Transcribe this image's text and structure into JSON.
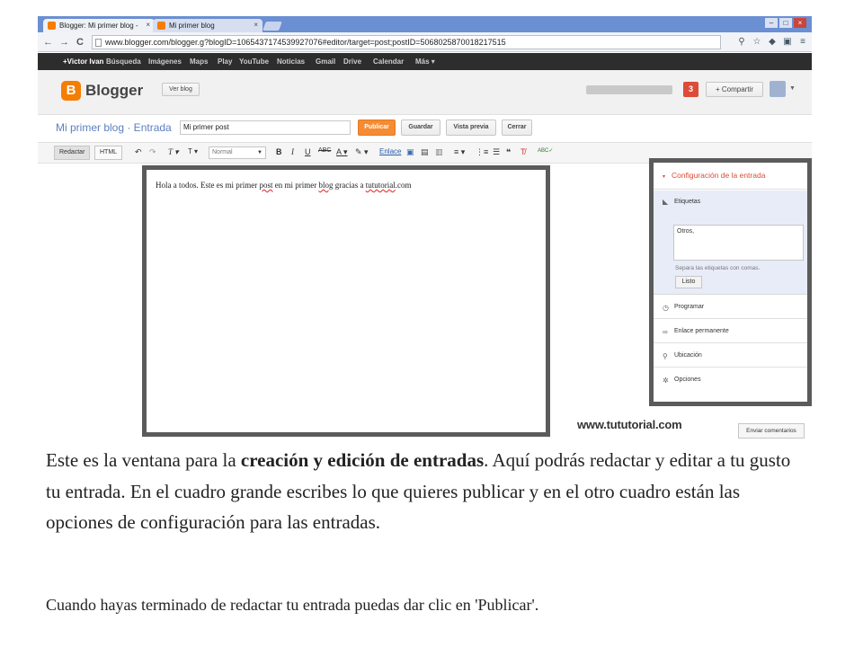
{
  "browser": {
    "tabs": [
      {
        "label": "Blogger: Mi primer blog -"
      },
      {
        "label": "Mi primer blog"
      }
    ],
    "close_glyph": "×",
    "url": "www.blogger.com/blogger.g?blogID=1065437174539927076#editor/target=post;postID=5068025870018217515",
    "window_controls": [
      "–",
      "□",
      "×"
    ],
    "nav": {
      "back": "←",
      "forward": "→",
      "reload": "C"
    },
    "toolbar_icons": [
      "search-icon",
      "star-icon",
      "extension-icon",
      "cast-icon",
      "menu-icon"
    ]
  },
  "google_bar": {
    "items": [
      "+Victor Ivan",
      "Búsqueda",
      "Imágenes",
      "Maps",
      "Play",
      "YouTube",
      "Noticias",
      "Gmail",
      "Drive",
      "Calendar",
      "Más ▾"
    ]
  },
  "blogger": {
    "logo_letter": "B",
    "brand": "Blogger",
    "view_blog": "Ver blog",
    "notifications": "3",
    "share": "+ Compartir"
  },
  "post": {
    "breadcrumb": "Mi primer blog · Entrada",
    "title_value": "Mi primer post",
    "buttons": {
      "publish": "Publicar",
      "save": "Guardar",
      "preview": "Vista previa",
      "close": "Cerrar"
    }
  },
  "editor_toolbar": {
    "mode_compose": "Redactar",
    "mode_html": "HTML",
    "undo": "↶",
    "redo": "↷",
    "font_family": "T ▾",
    "font_size": "T ▾",
    "font_select": "Normal",
    "bold": "B",
    "italic": "I",
    "underline": "U",
    "strike": "ABC",
    "text_color": "A ▾",
    "highlight": "✎ ▾",
    "link": "Enlace",
    "align": "≡ ▾",
    "numbered_list": "⋮≡",
    "bullet_list": "☰",
    "quote": "❝",
    "clear_format": "T̸",
    "spellcheck": "ABC✓"
  },
  "editor": {
    "parts": [
      "Hola a todos. Este es mi primer ",
      "post",
      " en mi primer ",
      "blog",
      " gracias a ",
      "tututorial",
      ".com"
    ]
  },
  "settings": {
    "title": "Configuración de la entrada",
    "expand_arrow": "▾",
    "labels_title": "Etiquetas",
    "labels_value": "Otros,",
    "labels_help": "Separa las etiquetas con comas.",
    "done": "Listo",
    "sections": [
      {
        "icon": "clock-icon",
        "glyph": "◷",
        "label": "Programar"
      },
      {
        "icon": "link-icon",
        "glyph": "∞",
        "label": "Enlace permanente"
      },
      {
        "icon": "location-pin-icon",
        "glyph": "⚲",
        "label": "Ubicación"
      },
      {
        "icon": "gear-icon",
        "glyph": "✲",
        "label": "Opciones"
      }
    ]
  },
  "watermark": "www.tututorial.com",
  "feedback_button": "Enviar comentarios",
  "caption": {
    "p1_before": "Este es la ventana para la ",
    "p1_bold": "creación y edición de entradas",
    "p1_after": ". Aquí podrás redactar y editar a tu gusto tu entrada. En el cuadro grande escribes lo que quieres publicar y en el otro cuadro están las opciones de configuración para las entradas.",
    "p2": "Cuando hayas terminado de redactar tu entrada puedas dar clic en 'Publicar'."
  },
  "colors": {
    "accent_orange": "#f57d00",
    "publish_button": "#f58b33",
    "settings_title": "#dd4b39",
    "link_blue": "#5b7fc1",
    "highlight_border": "#5b5b5b"
  }
}
